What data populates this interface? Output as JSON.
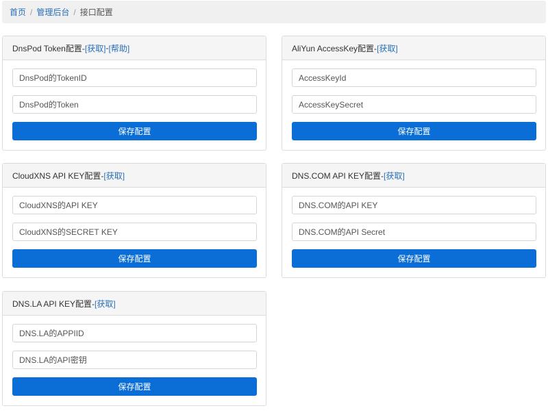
{
  "breadcrumb": {
    "home": "首页",
    "admin": "管理后台",
    "current": "接口配置",
    "separator": "/"
  },
  "panels": [
    {
      "title": "DnsPod Token配置-",
      "links": [
        "[获取]",
        "-",
        "[帮助]"
      ],
      "fields": [
        "DnsPod的TokenID",
        "DnsPod的Token"
      ],
      "button": "保存配置"
    },
    {
      "title": "AliYun AccessKey配置-",
      "links": [
        "[获取]"
      ],
      "fields": [
        "AccessKeyId",
        "AccessKeySecret"
      ],
      "button": "保存配置"
    },
    {
      "title": "CloudXNS API KEY配置-",
      "links": [
        "[获取]"
      ],
      "fields": [
        "CloudXNS的API KEY",
        "CloudXNS的SECRET KEY"
      ],
      "button": "保存配置"
    },
    {
      "title": "DNS.COM API KEY配置-",
      "links": [
        "[获取]"
      ],
      "fields": [
        "DNS.COM的API KEY",
        "DNS.COM的API Secret"
      ],
      "button": "保存配置"
    },
    {
      "title": "DNS.LA API KEY配置-",
      "links": [
        "[获取]"
      ],
      "fields": [
        "DNS.LA的APPIID",
        "DNS.LA的API密钥"
      ],
      "button": "保存配置"
    }
  ],
  "colors": {
    "primary_button": "#0a6ed6",
    "link": "#2a6fb8"
  }
}
